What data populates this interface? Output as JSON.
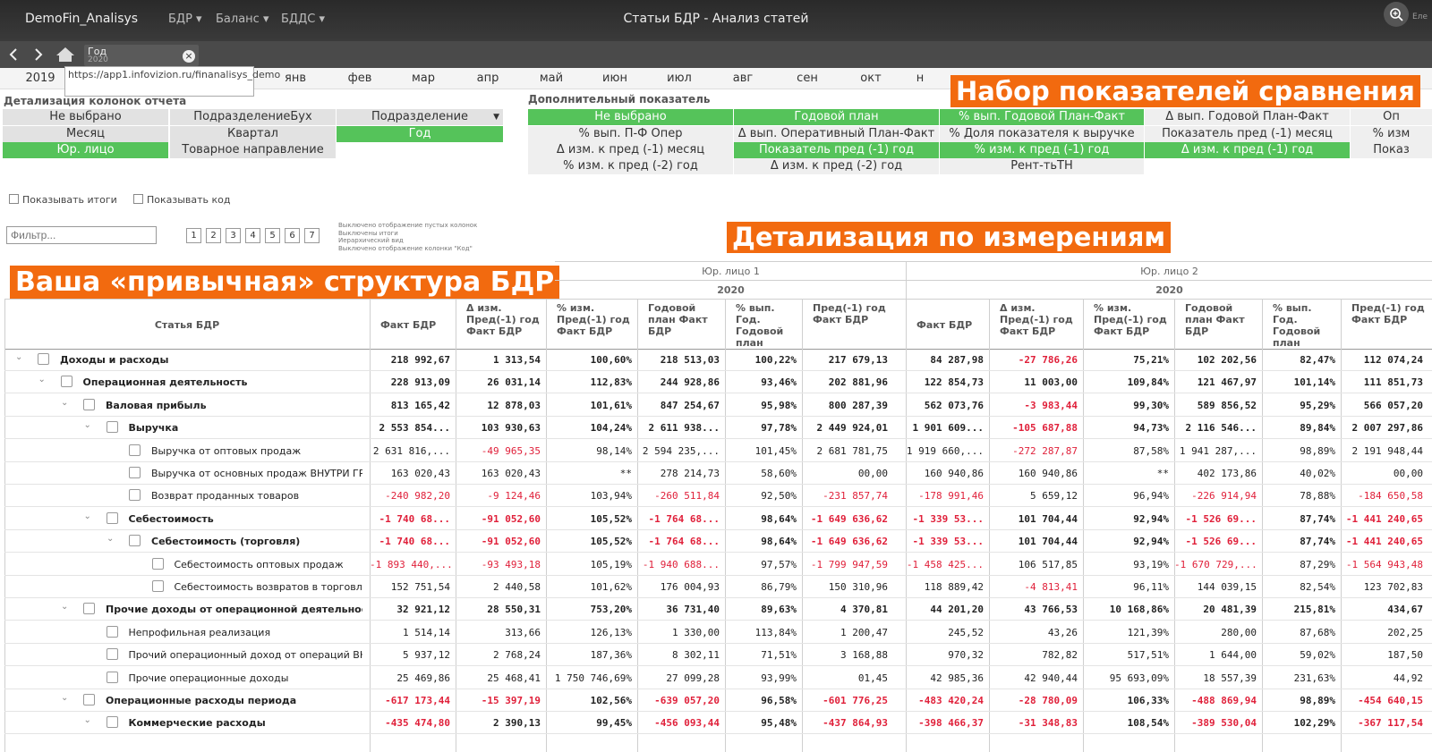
{
  "header": {
    "brand": "DemoFin_Analisys",
    "menus": [
      "БДР",
      "Баланс",
      "БДДС"
    ],
    "title": "Статьи БДР - Анализ статей",
    "user": "Еле"
  },
  "tab": {
    "label": "Год",
    "value": "2020",
    "close": "×"
  },
  "year": "2019",
  "url_tooltip": "https://app1.infovizion.ru/finanalisys_demo",
  "months": [
    "янв",
    "фев",
    "мар",
    "апр",
    "май",
    "июн",
    "июл",
    "авг",
    "сен",
    "окт",
    "н"
  ],
  "callouts": {
    "comparison": "Набор показателей сравнения",
    "dimensions": "Детализация по измерениям",
    "structure": "Ваша «привычная» структура БДР"
  },
  "detail_columns": {
    "label": "Детализация колонок отчета",
    "items": [
      "Не выбрано",
      "ПодразделениеБух",
      "Подразделение",
      "Месяц",
      "Квартал",
      "Год",
      "Юр. лицо",
      "Товарное направление"
    ]
  },
  "extra_indicator": {
    "label": "Дополнительный показатель",
    "items": [
      "Не выбрано",
      "Годовой план",
      "% вып. Годовой План-Факт",
      "Δ вып. Годовой План-Факт",
      "Оп",
      "% вып. П-Ф Опер",
      "Δ вып. Оперативный План-Факт",
      "% Доля показателя к выручке",
      "Показатель пред (-1) месяц",
      "% изм",
      "Δ изм. к пред (-1) месяц",
      "Показатель пред (-1) год",
      "% изм. к пред (-1) год",
      "Δ изм. к пред (-1) год",
      "Показ",
      "% изм. к пред (-2) год",
      "Δ изм. к пред (-2) год",
      "Рент-тьТН"
    ]
  },
  "options": {
    "show_totals": "Показывать итоги",
    "show_code": "Показывать код"
  },
  "filter": {
    "placeholder": "Фильтр..."
  },
  "levels": [
    "1",
    "2",
    "3",
    "4",
    "5",
    "6",
    "7"
  ],
  "notes": [
    "Выключено отображение пустых колонок",
    "Выключены итоги",
    "Иерархический вид",
    "Выключено отображение колонки \"Код\""
  ],
  "table": {
    "row_header": "Статья БДР",
    "groups": [
      {
        "entity": "Юр. лицо 1",
        "year": "2020"
      },
      {
        "entity": "Юр. лицо 2",
        "year": "2020"
      }
    ],
    "columns": [
      "Факт БДР",
      "Δ изм. Пред(-1) год Факт БДР",
      "% изм. Пред(-1) год Факт БДР",
      "Годовой план Факт БДР",
      "% вып. Год. Годовой план",
      "Пред(-1) год Факт БДР"
    ],
    "rows": [
      {
        "name": "Доходы и расходы",
        "level": 0,
        "bold": true,
        "expand": true,
        "values": [
          "218 992,67",
          "1 313,54",
          "100,60%",
          "218 513,03",
          "100,22%",
          "217 679,13",
          "84 287,98",
          "-27 786,26",
          "75,21%",
          "102 202,56",
          "82,47%",
          "112 074,24"
        ]
      },
      {
        "name": "Операционная деятельность",
        "level": 1,
        "bold": true,
        "expand": true,
        "values": [
          "228 913,09",
          "26 031,14",
          "112,83%",
          "244 928,86",
          "93,46%",
          "202 881,96",
          "122 854,73",
          "11 003,00",
          "109,84%",
          "121 467,97",
          "101,14%",
          "111 851,73"
        ]
      },
      {
        "name": "Валовая прибыль",
        "level": 2,
        "bold": true,
        "expand": true,
        "values": [
          "813 165,42",
          "12 878,03",
          "101,61%",
          "847 254,67",
          "95,98%",
          "800 287,39",
          "562 073,76",
          "-3 983,44",
          "99,30%",
          "589 856,52",
          "95,29%",
          "566 057,20"
        ]
      },
      {
        "name": "Выручка",
        "level": 3,
        "bold": true,
        "expand": true,
        "values": [
          "2 553 854...",
          "103 930,63",
          "104,24%",
          "2 611 938...",
          "97,78%",
          "2 449 924,01",
          "1 901 609...",
          "-105 687,88",
          "94,73%",
          "2 116 546...",
          "89,84%",
          "2 007 297,86"
        ]
      },
      {
        "name": "Выручка от оптовых продаж",
        "level": 4,
        "bold": false,
        "expand": false,
        "values": [
          "2 631 816,...",
          "-49 965,35",
          "98,14%",
          "2 594 235,...",
          "101,45%",
          "2 681 781,75",
          "1 919 660,...",
          "-272 287,87",
          "87,58%",
          "1 941 287,...",
          "98,89%",
          "2 191 948,44"
        ]
      },
      {
        "name": "Выручка от основных продаж ВНУТРИ ГР...",
        "level": 4,
        "bold": false,
        "expand": false,
        "values": [
          "163 020,43",
          "163 020,43",
          "**",
          "278 214,73",
          "58,60%",
          "00,00",
          "160 940,86",
          "160 940,86",
          "**",
          "402 173,86",
          "40,02%",
          "00,00"
        ]
      },
      {
        "name": "Возврат проданных товаров",
        "level": 4,
        "bold": false,
        "expand": false,
        "values": [
          "-240 982,20",
          "-9 124,46",
          "103,94%",
          "-260 511,84",
          "92,50%",
          "-231 857,74",
          "-178 991,46",
          "5 659,12",
          "96,94%",
          "-226 914,94",
          "78,88%",
          "-184 650,58"
        ]
      },
      {
        "name": "Себестоимость",
        "level": 3,
        "bold": true,
        "expand": true,
        "values": [
          "-1 740 68...",
          "-91 052,60",
          "105,52%",
          "-1 764 68...",
          "98,64%",
          "-1 649 636,62",
          "-1 339 53...",
          "101 704,44",
          "92,94%",
          "-1 526 69...",
          "87,74%",
          "-1 441 240,65"
        ]
      },
      {
        "name": "Себестоимость (торговля)",
        "level": 4,
        "bold": true,
        "expand": true,
        "values": [
          "-1 740 68...",
          "-91 052,60",
          "105,52%",
          "-1 764 68...",
          "98,64%",
          "-1 649 636,62",
          "-1 339 53...",
          "101 704,44",
          "92,94%",
          "-1 526 69...",
          "87,74%",
          "-1 441 240,65"
        ]
      },
      {
        "name": "Себестоимость оптовых продаж",
        "level": 5,
        "bold": false,
        "expand": false,
        "values": [
          "-1 893 440,...",
          "-93 493,18",
          "105,19%",
          "-1 940 688...",
          "97,57%",
          "-1 799 947,59",
          "-1 458 425...",
          "106 517,85",
          "93,19%",
          "-1 670 729,...",
          "87,29%",
          "-1 564 943,48"
        ]
      },
      {
        "name": "Себестоимость возвратов в торговле",
        "level": 5,
        "bold": false,
        "expand": false,
        "values": [
          "152 751,54",
          "2 440,58",
          "101,62%",
          "176 004,93",
          "86,79%",
          "150 310,96",
          "118 889,42",
          "-4 813,41",
          "96,11%",
          "144 039,15",
          "82,54%",
          "123 702,83"
        ]
      },
      {
        "name": "Прочие доходы от операционной деятельности",
        "level": 2,
        "bold": true,
        "expand": true,
        "values": [
          "32 921,12",
          "28 550,31",
          "753,20%",
          "36 731,40",
          "89,63%",
          "4 370,81",
          "44 201,20",
          "43 766,53",
          "10 168,86%",
          "20 481,39",
          "215,81%",
          "434,67"
        ]
      },
      {
        "name": "Непрофильная реализация",
        "level": 3,
        "bold": false,
        "expand": false,
        "values": [
          "1 514,14",
          "313,66",
          "126,13%",
          "1 330,00",
          "113,84%",
          "1 200,47",
          "245,52",
          "43,26",
          "121,39%",
          "280,00",
          "87,68%",
          "202,25"
        ]
      },
      {
        "name": "Прочий операционный доход от операций ВН...",
        "level": 3,
        "bold": false,
        "expand": false,
        "values": [
          "5 937,12",
          "2 768,24",
          "187,36%",
          "8 302,11",
          "71,51%",
          "3 168,88",
          "970,32",
          "782,82",
          "517,51%",
          "1 644,00",
          "59,02%",
          "187,50"
        ]
      },
      {
        "name": "Прочие операционные доходы",
        "level": 3,
        "bold": false,
        "expand": false,
        "values": [
          "25 469,86",
          "25 468,41",
          "1 750 746,69%",
          "27 099,28",
          "93,99%",
          "01,45",
          "42 985,36",
          "42 940,44",
          "95 693,09%",
          "18 557,39",
          "231,63%",
          "44,92"
        ]
      },
      {
        "name": "Операционные расходы периода",
        "level": 2,
        "bold": true,
        "expand": true,
        "values": [
          "-617 173,44",
          "-15 397,19",
          "102,56%",
          "-639 057,20",
          "96,58%",
          "-601 776,25",
          "-483 420,24",
          "-28 780,09",
          "106,33%",
          "-488 869,94",
          "98,89%",
          "-454 640,15"
        ]
      },
      {
        "name": "Коммерческие расходы",
        "level": 3,
        "bold": true,
        "expand": true,
        "values": [
          "-435 474,80",
          "2 390,13",
          "99,45%",
          "-456 093,44",
          "95,48%",
          "-437 864,93",
          "-398 466,37",
          "-31 348,83",
          "108,54%",
          "-389 530,04",
          "102,29%",
          "-367 117,54"
        ]
      }
    ]
  },
  "colors": {
    "accent_green": "#55c35a",
    "callout_orange": "#f26a0f",
    "negative_red": "#e0203a"
  }
}
